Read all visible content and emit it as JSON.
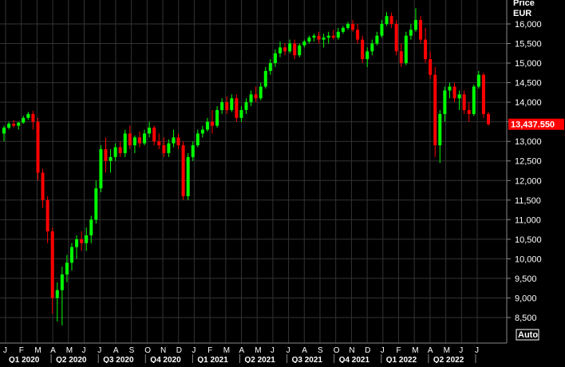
{
  "chart_data": {
    "type": "candlestick",
    "price_header": "Price",
    "currency": "EUR",
    "last_price_label": "13,437.550",
    "last_price": 13437.55,
    "auto_label": "Auto",
    "ylim": [
      8000,
      16500
    ],
    "y_ticks": [
      {
        "value": 16000,
        "label": "16,000"
      },
      {
        "value": 15500,
        "label": "15,500"
      },
      {
        "value": 15000,
        "label": "15,000"
      },
      {
        "value": 14500,
        "label": "14,500"
      },
      {
        "value": 14000,
        "label": "14,000"
      },
      {
        "value": 13500,
        "label": "13,500"
      },
      {
        "value": 13000,
        "label": "13,000"
      },
      {
        "value": 12500,
        "label": "12,500"
      },
      {
        "value": 12000,
        "label": "12,000"
      },
      {
        "value": 11500,
        "label": "11,500"
      },
      {
        "value": 11000,
        "label": "11,000"
      },
      {
        "value": 10500,
        "label": "10,500"
      },
      {
        "value": 10000,
        "label": "10,000"
      },
      {
        "value": 9500,
        "label": "9,500"
      },
      {
        "value": 9000,
        "label": "9,000"
      },
      {
        "value": 8500,
        "label": "8,500"
      }
    ],
    "month_labels": [
      "J",
      "F",
      "M",
      "A",
      "M",
      "J",
      "J",
      "A",
      "S",
      "O",
      "N",
      "D",
      "J",
      "F",
      "M",
      "A",
      "M",
      "J",
      "J",
      "A",
      "S",
      "O",
      "N",
      "D",
      "J",
      "F",
      "M",
      "A",
      "M",
      "J",
      "J"
    ],
    "quarter_labels": [
      "Q1 2020",
      "Q2 2020",
      "Q3 2020",
      "Q4 2020",
      "Q1 2021",
      "Q2 2021",
      "Q3 2021",
      "Q4 2021",
      "Q1 2022",
      "Q2 2022"
    ],
    "colors": {
      "up": "#00ff00",
      "down": "#ff0000",
      "grid": "#333333",
      "axis_text": "#ffffff",
      "last_price_bg": "#ff0000"
    },
    "candle_interval": "weekly",
    "start_date": "2019-12-30",
    "candles": [
      [
        13200,
        13400,
        13000,
        13350
      ],
      [
        13350,
        13500,
        13300,
        13450
      ],
      [
        13450,
        13550,
        13350,
        13400
      ],
      [
        13400,
        13500,
        13300,
        13480
      ],
      [
        13480,
        13650,
        13450,
        13600
      ],
      [
        13600,
        13750,
        13550,
        13700
      ],
      [
        13700,
        13780,
        13300,
        13500
      ],
      [
        13500,
        13600,
        12000,
        12200
      ],
      [
        12200,
        12300,
        11300,
        11500
      ],
      [
        11500,
        11600,
        10400,
        10700
      ],
      [
        10700,
        10800,
        8600,
        9000
      ],
      [
        9000,
        9400,
        8400,
        9200
      ],
      [
        9200,
        9800,
        8300,
        9600
      ],
      [
        9600,
        10100,
        9400,
        9900
      ],
      [
        9900,
        10400,
        9700,
        10300
      ],
      [
        10300,
        10600,
        10000,
        10500
      ],
      [
        10500,
        10700,
        10200,
        10400
      ],
      [
        10400,
        10800,
        10200,
        10600
      ],
      [
        10600,
        11100,
        10400,
        11000
      ],
      [
        11000,
        12000,
        10900,
        11800
      ],
      [
        11800,
        12900,
        11700,
        12800
      ],
      [
        12800,
        13100,
        12200,
        12500
      ],
      [
        12500,
        12800,
        12200,
        12600
      ],
      [
        12600,
        12950,
        12500,
        12850
      ],
      [
        12850,
        13000,
        12600,
        12700
      ],
      [
        12700,
        13300,
        12600,
        13200
      ],
      [
        13200,
        13400,
        12800,
        12900
      ],
      [
        12900,
        13150,
        12700,
        13100
      ],
      [
        13100,
        13250,
        12850,
        12950
      ],
      [
        12950,
        13300,
        12900,
        13200
      ],
      [
        13200,
        13500,
        13100,
        13350
      ],
      [
        13350,
        13400,
        12900,
        13000
      ],
      [
        13000,
        13200,
        12800,
        12900
      ],
      [
        12900,
        13100,
        12600,
        12700
      ],
      [
        12700,
        13050,
        12600,
        12950
      ],
      [
        12950,
        13300,
        12850,
        13100
      ],
      [
        13100,
        13200,
        12800,
        12900
      ],
      [
        12900,
        13000,
        11500,
        11600
      ],
      [
        11600,
        12700,
        11500,
        12600
      ],
      [
        12600,
        13000,
        12500,
        12900
      ],
      [
        12900,
        13300,
        12850,
        13200
      ],
      [
        13200,
        13400,
        13100,
        13300
      ],
      [
        13300,
        13600,
        13250,
        13500
      ],
      [
        13500,
        13800,
        13200,
        13400
      ],
      [
        13400,
        13900,
        13350,
        13800
      ],
      [
        13800,
        14100,
        13700,
        14000
      ],
      [
        14000,
        14150,
        13700,
        13800
      ],
      [
        13800,
        14200,
        13750,
        14100
      ],
      [
        14100,
        14200,
        13500,
        13600
      ],
      [
        13600,
        13900,
        13500,
        13800
      ],
      [
        13800,
        14100,
        13700,
        14000
      ],
      [
        14000,
        14300,
        13900,
        14200
      ],
      [
        14200,
        14400,
        14000,
        14100
      ],
      [
        14100,
        14500,
        14050,
        14400
      ],
      [
        14400,
        14900,
        14350,
        14800
      ],
      [
        14800,
        15100,
        14700,
        15000
      ],
      [
        15000,
        15350,
        14900,
        15250
      ],
      [
        15250,
        15550,
        15150,
        15400
      ],
      [
        15400,
        15500,
        15200,
        15300
      ],
      [
        15300,
        15600,
        15250,
        15500
      ],
      [
        15500,
        15600,
        15100,
        15200
      ],
      [
        15200,
        15500,
        15150,
        15450
      ],
      [
        15450,
        15600,
        15400,
        15550
      ],
      [
        15550,
        15700,
        15500,
        15650
      ],
      [
        15650,
        15750,
        15550,
        15700
      ],
      [
        15700,
        15800,
        15500,
        15600
      ],
      [
        15600,
        15750,
        15400,
        15650
      ],
      [
        15650,
        15800,
        15500,
        15700
      ],
      [
        15700,
        15850,
        15600,
        15650
      ],
      [
        15650,
        15900,
        15600,
        15800
      ],
      [
        15800,
        15950,
        15750,
        15900
      ],
      [
        15900,
        16050,
        15850,
        16000
      ],
      [
        16000,
        16100,
        15800,
        15850
      ],
      [
        15850,
        16000,
        15500,
        15600
      ],
      [
        15600,
        15700,
        15000,
        15100
      ],
      [
        15100,
        15400,
        14900,
        15300
      ],
      [
        15300,
        15600,
        15200,
        15500
      ],
      [
        15500,
        15800,
        15450,
        15700
      ],
      [
        15700,
        16100,
        15650,
        16000
      ],
      [
        16000,
        16300,
        15950,
        16200
      ],
      [
        16200,
        16290,
        15900,
        16000
      ],
      [
        16000,
        16100,
        15200,
        15300
      ],
      [
        15300,
        15500,
        14900,
        15000
      ],
      [
        15000,
        15800,
        14950,
        15700
      ],
      [
        15700,
        16000,
        15600,
        15850
      ],
      [
        15850,
        16400,
        15800,
        16100
      ],
      [
        16100,
        16200,
        15500,
        15600
      ],
      [
        15600,
        15900,
        15000,
        15100
      ],
      [
        15100,
        15300,
        14600,
        14700
      ],
      [
        14700,
        14900,
        12600,
        12900
      ],
      [
        12900,
        13800,
        12450,
        13700
      ],
      [
        13700,
        14400,
        13500,
        14300
      ],
      [
        14300,
        14500,
        14100,
        14400
      ],
      [
        14400,
        14500,
        14000,
        14100
      ],
      [
        14100,
        14300,
        13800,
        14200
      ],
      [
        14200,
        14300,
        13700,
        13800
      ],
      [
        13800,
        14000,
        13500,
        13700
      ],
      [
        13700,
        14450,
        13650,
        14400
      ],
      [
        14400,
        14800,
        14350,
        14700
      ],
      [
        14700,
        14750,
        13600,
        13700
      ],
      [
        13700,
        13750,
        13400,
        13437.55
      ]
    ]
  }
}
